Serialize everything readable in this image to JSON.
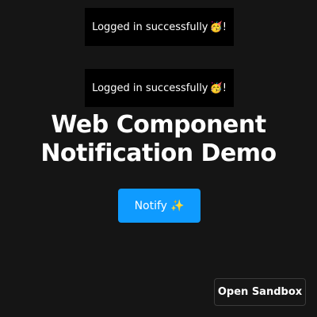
{
  "toasts": [
    {
      "message": "Logged in successfully",
      "emoji": "🥳",
      "suffix": "!"
    },
    {
      "message": "Logged in successfully",
      "emoji": "🥳",
      "suffix": "!"
    }
  ],
  "heading": {
    "line1": "Web Component",
    "line2": "Notification Demo"
  },
  "notify_button": {
    "label": "Notify",
    "emoji": "✨",
    "color": "#0f9bff"
  },
  "sandbox_button": {
    "label": "Open Sandbox"
  },
  "colors": {
    "background": "#151515",
    "toast_background": "#000000"
  }
}
